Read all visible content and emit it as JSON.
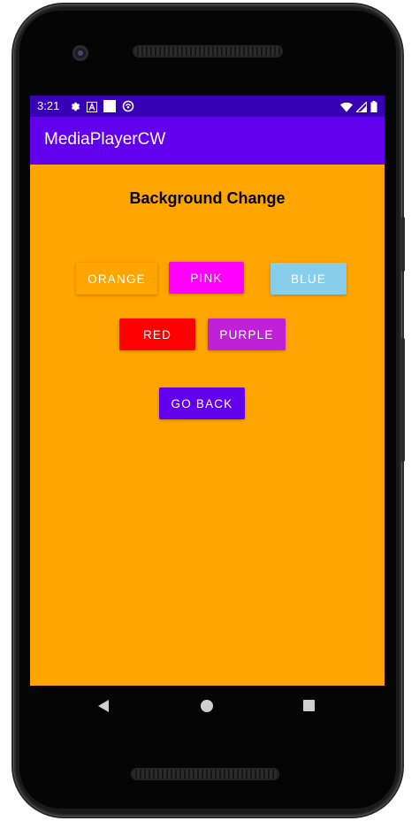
{
  "status_bar": {
    "time": "3:21",
    "left_icons": [
      "gear-icon",
      "a-icon",
      "square-icon",
      "sync-icon"
    ],
    "right_icons": [
      "wifi-icon",
      "signal-icon",
      "battery-icon"
    ]
  },
  "app_bar": {
    "title": "MediaPlayerCW"
  },
  "main": {
    "heading": "Background Change",
    "buttons": {
      "orange": {
        "label": "ORANGE",
        "color": "#ffa500"
      },
      "pink": {
        "label": "PINK",
        "color": "#ff00ff"
      },
      "blue": {
        "label": "BLUE",
        "color": "#87ceeb"
      },
      "red": {
        "label": "RED",
        "color": "#ff0000"
      },
      "purple": {
        "label": "PURPLE",
        "color": "#c020d8"
      },
      "go_back": {
        "label": "GO BACK",
        "color": "#6200ee"
      }
    }
  },
  "colors": {
    "background": "#ffa500",
    "status_bar": "#3700b3",
    "app_bar": "#6200ee"
  },
  "nav_bar": {
    "icons": [
      "back-icon",
      "home-icon",
      "recents-icon"
    ]
  }
}
